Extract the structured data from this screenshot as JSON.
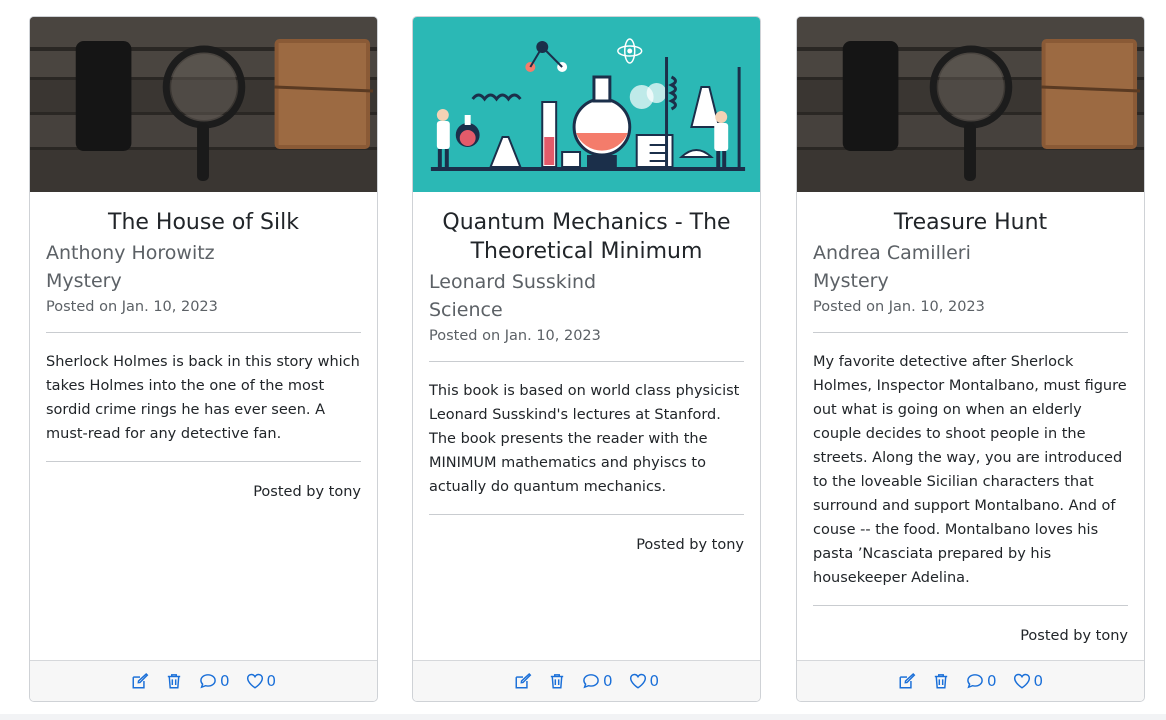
{
  "cards": [
    {
      "title": "The House of Silk",
      "author": "Anthony Horowitz",
      "category": "Mystery",
      "posted_on": "Posted on Jan. 10, 2023",
      "description": "Sherlock Holmes is back in this story which takes Holmes into the one of the most sordid crime rings he has ever seen. A must-read for any detective fan.",
      "posted_by": "Posted by tony",
      "image": "detective-desk-photo",
      "comments": "0",
      "likes": "0"
    },
    {
      "title": "Quantum Mechanics - The Theoretical Minimum",
      "author": "Leonard Susskind",
      "category": "Science",
      "posted_on": "Posted on Jan. 10, 2023",
      "description": "This book is based on world class physicist Leonard Susskind's lectures at Stanford. The book presents the reader with the MINIMUM mathematics and phyiscs to actually do quantum mechanics.",
      "posted_by": "Posted by tony",
      "image": "science-lab-illustration",
      "comments": "0",
      "likes": "0"
    },
    {
      "title": "Treasure Hunt",
      "author": "Andrea Camilleri",
      "category": "Mystery",
      "posted_on": "Posted on Jan. 10, 2023",
      "description": "My favorite detective after Sherlock Holmes, Inspector Montalbano, must figure out what is going on when an elderly couple decides to shoot people in the streets. Along the way, you are introduced to the loveable Sicilian characters that surround and support Montalbano. And of couse -- the food. Montalbano loves his pasta ’Ncasciata prepared by his housekeeper Adelina.",
      "posted_by": "Posted by tony",
      "image": "detective-desk-photo",
      "comments": "0",
      "likes": "0"
    }
  ],
  "icons": {
    "edit": "edit-icon",
    "delete": "trash-icon",
    "comment": "comment-icon",
    "like": "heart-icon"
  },
  "colors": {
    "accent": "#1a6fd8",
    "lab_bg": "#2bb8b5"
  }
}
